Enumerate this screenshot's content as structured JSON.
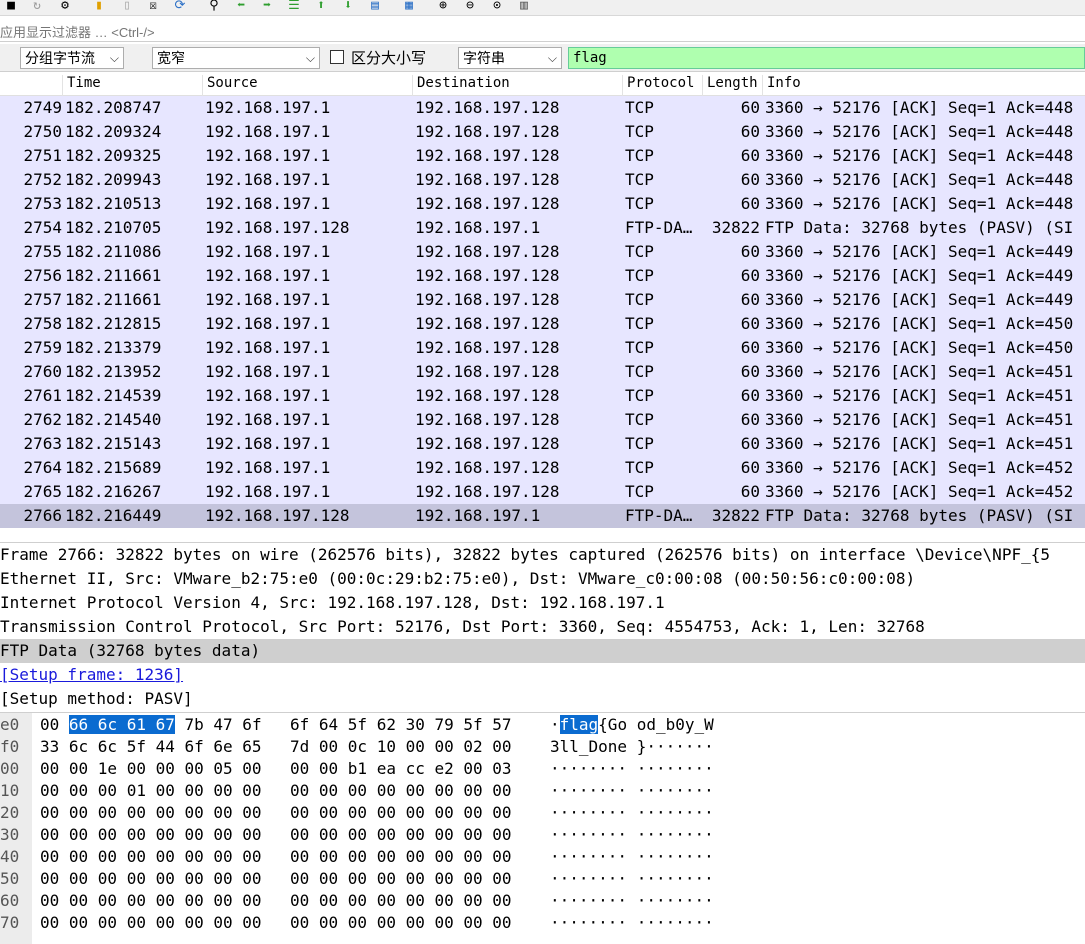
{
  "toolbar": {
    "icons": [
      "stop-icon",
      "restart-icon",
      "options-icon",
      "open-icon",
      "save-icon",
      "close-file-icon",
      "reload-icon",
      "find-icon",
      "back-icon",
      "forward-icon",
      "goto-icon",
      "first-icon",
      "last-icon",
      "autoscroll-icon",
      "colorize-icon",
      "zoom-in-icon",
      "zoom-out-icon",
      "zoom-reset-icon",
      "resize-columns-icon"
    ]
  },
  "filter": {
    "placeholder": "应用显示过滤器 … <Ctrl-/>"
  },
  "find": {
    "search_in": "分组字节流",
    "charset": "宽窄",
    "case_label": "区分大小写",
    "type": "字符串",
    "query": "flag"
  },
  "columns": {
    "no": "",
    "time": "Time",
    "source": "Source",
    "destination": "Destination",
    "protocol": "Protocol",
    "length": "Length",
    "info": "Info"
  },
  "packets": [
    {
      "no": "2749",
      "time": "182.208747",
      "src": "192.168.197.1",
      "dst": "192.168.197.128",
      "proto": "TCP",
      "len": "60",
      "info": "3360 → 52176 [ACK] Seq=1 Ack=448"
    },
    {
      "no": "2750",
      "time": "182.209324",
      "src": "192.168.197.1",
      "dst": "192.168.197.128",
      "proto": "TCP",
      "len": "60",
      "info": "3360 → 52176 [ACK] Seq=1 Ack=448"
    },
    {
      "no": "2751",
      "time": "182.209325",
      "src": "192.168.197.1",
      "dst": "192.168.197.128",
      "proto": "TCP",
      "len": "60",
      "info": "3360 → 52176 [ACK] Seq=1 Ack=448"
    },
    {
      "no": "2752",
      "time": "182.209943",
      "src": "192.168.197.1",
      "dst": "192.168.197.128",
      "proto": "TCP",
      "len": "60",
      "info": "3360 → 52176 [ACK] Seq=1 Ack=448"
    },
    {
      "no": "2753",
      "time": "182.210513",
      "src": "192.168.197.1",
      "dst": "192.168.197.128",
      "proto": "TCP",
      "len": "60",
      "info": "3360 → 52176 [ACK] Seq=1 Ack=448"
    },
    {
      "no": "2754",
      "time": "182.210705",
      "src": "192.168.197.128",
      "dst": "192.168.197.1",
      "proto": "FTP-DA…",
      "len": "32822",
      "info": "FTP Data: 32768 bytes (PASV) (SI"
    },
    {
      "no": "2755",
      "time": "182.211086",
      "src": "192.168.197.1",
      "dst": "192.168.197.128",
      "proto": "TCP",
      "len": "60",
      "info": "3360 → 52176 [ACK] Seq=1 Ack=449"
    },
    {
      "no": "2756",
      "time": "182.211661",
      "src": "192.168.197.1",
      "dst": "192.168.197.128",
      "proto": "TCP",
      "len": "60",
      "info": "3360 → 52176 [ACK] Seq=1 Ack=449"
    },
    {
      "no": "2757",
      "time": "182.211661",
      "src": "192.168.197.1",
      "dst": "192.168.197.128",
      "proto": "TCP",
      "len": "60",
      "info": "3360 → 52176 [ACK] Seq=1 Ack=449"
    },
    {
      "no": "2758",
      "time": "182.212815",
      "src": "192.168.197.1",
      "dst": "192.168.197.128",
      "proto": "TCP",
      "len": "60",
      "info": "3360 → 52176 [ACK] Seq=1 Ack=450"
    },
    {
      "no": "2759",
      "time": "182.213379",
      "src": "192.168.197.1",
      "dst": "192.168.197.128",
      "proto": "TCP",
      "len": "60",
      "info": "3360 → 52176 [ACK] Seq=1 Ack=450"
    },
    {
      "no": "2760",
      "time": "182.213952",
      "src": "192.168.197.1",
      "dst": "192.168.197.128",
      "proto": "TCP",
      "len": "60",
      "info": "3360 → 52176 [ACK] Seq=1 Ack=451"
    },
    {
      "no": "2761",
      "time": "182.214539",
      "src": "192.168.197.1",
      "dst": "192.168.197.128",
      "proto": "TCP",
      "len": "60",
      "info": "3360 → 52176 [ACK] Seq=1 Ack=451"
    },
    {
      "no": "2762",
      "time": "182.214540",
      "src": "192.168.197.1",
      "dst": "192.168.197.128",
      "proto": "TCP",
      "len": "60",
      "info": "3360 → 52176 [ACK] Seq=1 Ack=451"
    },
    {
      "no": "2763",
      "time": "182.215143",
      "src": "192.168.197.1",
      "dst": "192.168.197.128",
      "proto": "TCP",
      "len": "60",
      "info": "3360 → 52176 [ACK] Seq=1 Ack=451"
    },
    {
      "no": "2764",
      "time": "182.215689",
      "src": "192.168.197.1",
      "dst": "192.168.197.128",
      "proto": "TCP",
      "len": "60",
      "info": "3360 → 52176 [ACK] Seq=1 Ack=452"
    },
    {
      "no": "2765",
      "time": "182.216267",
      "src": "192.168.197.1",
      "dst": "192.168.197.128",
      "proto": "TCP",
      "len": "60",
      "info": "3360 → 52176 [ACK] Seq=1 Ack=452"
    },
    {
      "no": "2766",
      "time": "182.216449",
      "src": "192.168.197.128",
      "dst": "192.168.197.1",
      "proto": "FTP-DA…",
      "len": "32822",
      "info": "FTP Data: 32768 bytes (PASV) (SI"
    }
  ],
  "details": [
    "Frame 2766: 32822 bytes on wire (262576 bits), 32822 bytes captured (262576 bits) on interface \\Device\\NPF_{5",
    "Ethernet II, Src: VMware_b2:75:e0 (00:0c:29:b2:75:e0), Dst: VMware_c0:00:08 (00:50:56:c0:00:08)",
    "Internet Protocol Version 4, Src: 192.168.197.128, Dst: 192.168.197.1",
    "Transmission Control Protocol, Src Port: 52176, Dst Port: 3360, Seq: 4554753, Ack: 1, Len: 32768",
    "FTP Data (32768 bytes data)",
    "[Setup frame: 1236]",
    "[Setup method: PASV]"
  ],
  "hex": [
    {
      "off": "e0",
      "h1_pre": "00 ",
      "h1_mark": "66 6c 61 67",
      "h1_post": " 7b 47 6f",
      "h2": "6f 64 5f 62 30 79 5f 57",
      "a_pre": "·",
      "a_mark": "flag",
      "a_post": "{Go od_b0y_W"
    },
    {
      "off": "f0",
      "h1_pre": "33 6c 6c 5f 44 6f 6e 65",
      "h1_mark": "",
      "h1_post": "",
      "h2": "7d 00 0c 10 00 00 02 00",
      "a_pre": "3ll_Done }·······",
      "a_mark": "",
      "a_post": ""
    },
    {
      "off": "00",
      "h1_pre": "00 00 1e 00 00 00 05 00",
      "h1_mark": "",
      "h1_post": "",
      "h2": "00 00 b1 ea cc e2 00 03",
      "a_pre": "········ ········",
      "a_mark": "",
      "a_post": ""
    },
    {
      "off": "10",
      "h1_pre": "00 00 00 01 00 00 00 00",
      "h1_mark": "",
      "h1_post": "",
      "h2": "00 00 00 00 00 00 00 00",
      "a_pre": "········ ········",
      "a_mark": "",
      "a_post": ""
    },
    {
      "off": "20",
      "h1_pre": "00 00 00 00 00 00 00 00",
      "h1_mark": "",
      "h1_post": "",
      "h2": "00 00 00 00 00 00 00 00",
      "a_pre": "········ ········",
      "a_mark": "",
      "a_post": ""
    },
    {
      "off": "30",
      "h1_pre": "00 00 00 00 00 00 00 00",
      "h1_mark": "",
      "h1_post": "",
      "h2": "00 00 00 00 00 00 00 00",
      "a_pre": "········ ········",
      "a_mark": "",
      "a_post": ""
    },
    {
      "off": "40",
      "h1_pre": "00 00 00 00 00 00 00 00",
      "h1_mark": "",
      "h1_post": "",
      "h2": "00 00 00 00 00 00 00 00",
      "a_pre": "········ ········",
      "a_mark": "",
      "a_post": ""
    },
    {
      "off": "50",
      "h1_pre": "00 00 00 00 00 00 00 00",
      "h1_mark": "",
      "h1_post": "",
      "h2": "00 00 00 00 00 00 00 00",
      "a_pre": "········ ········",
      "a_mark": "",
      "a_post": ""
    },
    {
      "off": "60",
      "h1_pre": "00 00 00 00 00 00 00 00",
      "h1_mark": "",
      "h1_post": "",
      "h2": "00 00 00 00 00 00 00 00",
      "a_pre": "········ ········",
      "a_mark": "",
      "a_post": ""
    },
    {
      "off": "70",
      "h1_pre": "00 00 00 00 00 00 00 00",
      "h1_mark": "",
      "h1_post": "",
      "h2": "00 00 00 00 00 00 00 00",
      "a_pre": "········ ········",
      "a_mark": "",
      "a_post": ""
    }
  ],
  "colors": {
    "row_bg": "#e7e6ff",
    "row_selected": "#c4c4dc",
    "search_bg": "#afffaf",
    "highlight": "#0a6bd0",
    "link": "#1a1adb"
  }
}
